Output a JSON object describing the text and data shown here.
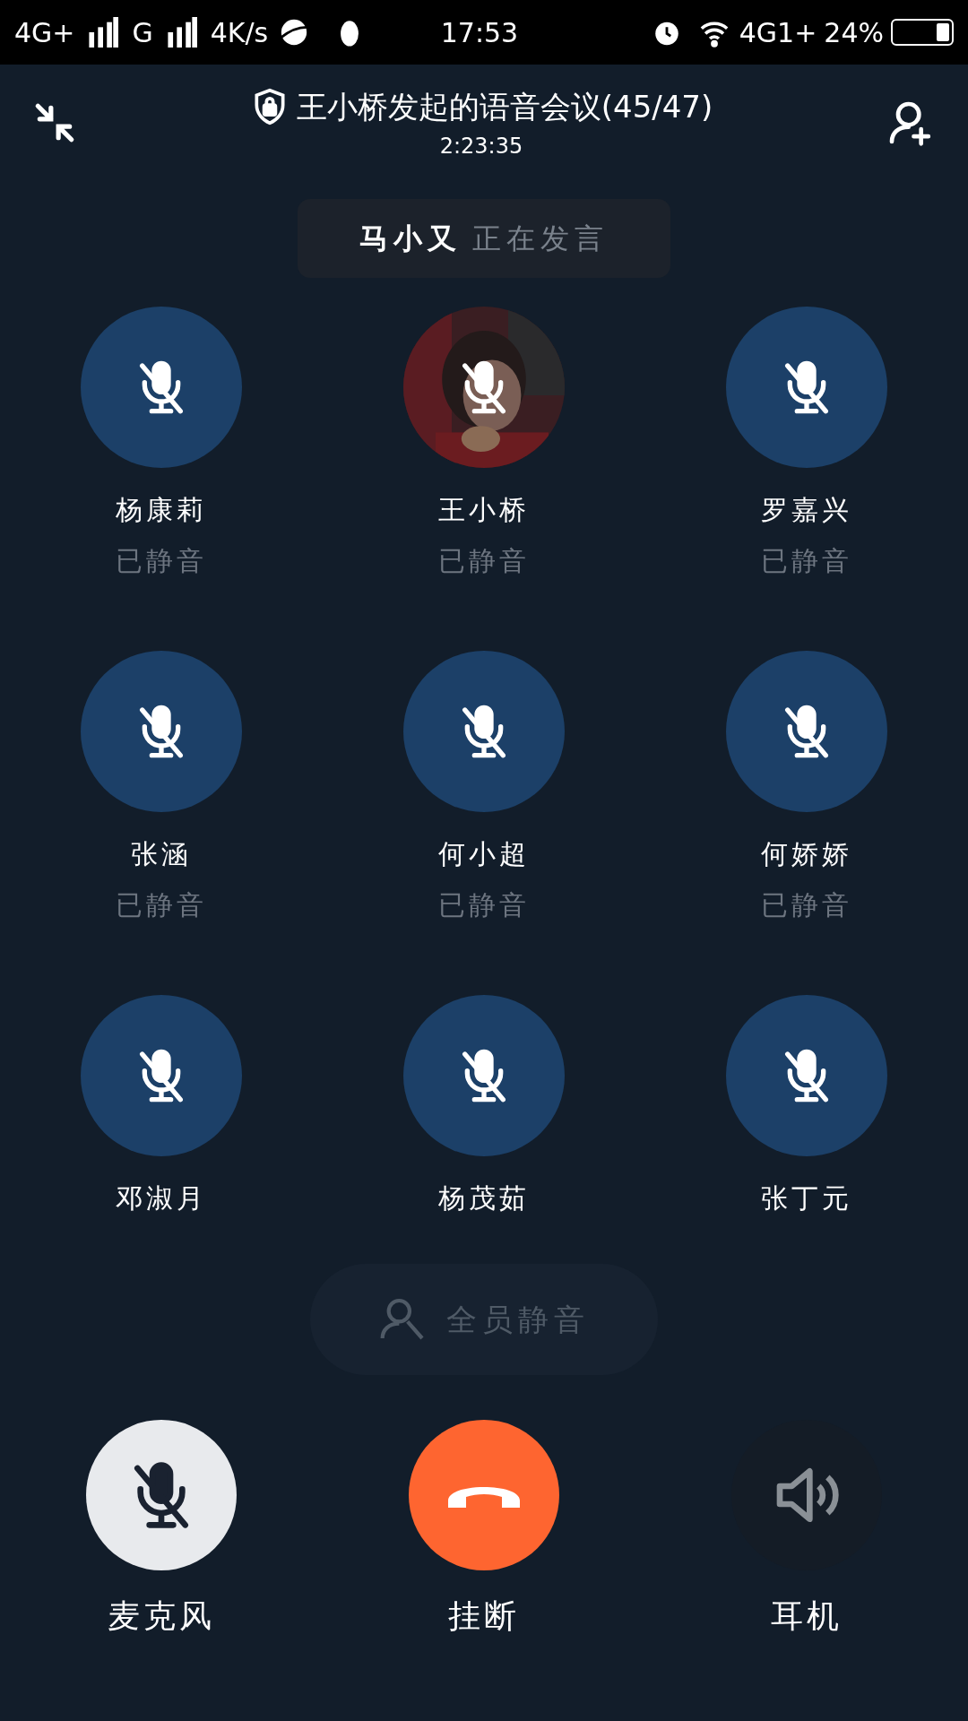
{
  "status_bar": {
    "left": [
      "4G+",
      "G",
      "4K/s"
    ],
    "time": "17:53",
    "network": "4G1+",
    "battery": "24%"
  },
  "header": {
    "title": "王小桥发起的语音会议(45/47)",
    "duration": "2:23:35"
  },
  "speaking": {
    "name": "马小又",
    "label": "正在发言"
  },
  "participants": [
    {
      "name": "杨康莉",
      "status": "已静音",
      "kind": "plain",
      "muted": true
    },
    {
      "name": "王小桥",
      "status": "已静音",
      "kind": "picture",
      "muted": true
    },
    {
      "name": "罗嘉兴",
      "status": "已静音",
      "kind": "plain",
      "muted": true
    },
    {
      "name": "张涵",
      "status": "已静音",
      "kind": "plain",
      "muted": true
    },
    {
      "name": "何小超",
      "status": "已静音",
      "kind": "plain",
      "muted": true
    },
    {
      "name": "何娇娇",
      "status": "已静音",
      "kind": "plain",
      "muted": true
    },
    {
      "name": "邓淑月",
      "kind": "plain",
      "muted": true
    },
    {
      "name": "杨茂茹",
      "kind": "plain",
      "muted": true
    },
    {
      "name": "张丁元",
      "kind": "plain",
      "muted": true
    }
  ],
  "mute_all": {
    "label": "全员静音",
    "disabled": true
  },
  "controls": [
    {
      "kind": "mic",
      "label": "麦克风",
      "on": true
    },
    {
      "kind": "hangup",
      "label": "挂断"
    },
    {
      "kind": "speaker",
      "label": "耳机",
      "on": false
    }
  ]
}
